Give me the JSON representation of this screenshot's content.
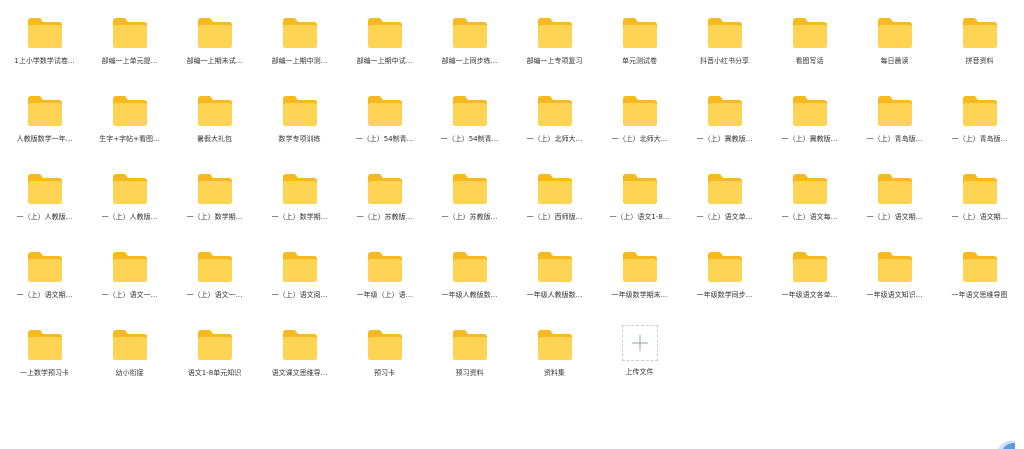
{
  "colors": {
    "folder_back": "#F6B91F",
    "folder_front": "#FFD455",
    "upload_border": "#C9CFDC",
    "upload_plus": "#9AA3B5"
  },
  "folders": [
    {
      "label": "1上小学数学试卷..."
    },
    {
      "label": "部编一上单元提..."
    },
    {
      "label": "部编一上期末试..."
    },
    {
      "label": "部编一上期中测..."
    },
    {
      "label": "部编一上期中试..."
    },
    {
      "label": "部编一上同步练..."
    },
    {
      "label": "部编一上专项复习"
    },
    {
      "label": "单元测试卷"
    },
    {
      "label": "抖音小红书分享"
    },
    {
      "label": "看图写话"
    },
    {
      "label": "每日晨读"
    },
    {
      "label": "拼音资料"
    },
    {
      "label": "人教版数学一年..."
    },
    {
      "label": "生字+字帖+看图..."
    },
    {
      "label": "暑假大礼包"
    },
    {
      "label": "数学专项训练"
    },
    {
      "label": "一（上）54制青..."
    },
    {
      "label": "一（上）54制青..."
    },
    {
      "label": "一（上）北师大..."
    },
    {
      "label": "一（上）北师大..."
    },
    {
      "label": "一（上）冀教版..."
    },
    {
      "label": "一（上）冀教版..."
    },
    {
      "label": "一（上）青岛版..."
    },
    {
      "label": "一（上）青岛版..."
    },
    {
      "label": "一（上）人教版..."
    },
    {
      "label": "一（上）人教版..."
    },
    {
      "label": "一（上）数学期..."
    },
    {
      "label": "一（上）数学期..."
    },
    {
      "label": "一（上）苏教版..."
    },
    {
      "label": "一（上）苏教版..."
    },
    {
      "label": "一（上）西师版..."
    },
    {
      "label": "一（上）语文1-8..."
    },
    {
      "label": "一（上）语文单..."
    },
    {
      "label": "一（上）语文每..."
    },
    {
      "label": "一（上）语文期..."
    },
    {
      "label": "一（上）语文期..."
    },
    {
      "label": "一（上）语文期..."
    },
    {
      "label": "一（上）语文一..."
    },
    {
      "label": "一（上）语文一..."
    },
    {
      "label": "一（上）语文阅..."
    },
    {
      "label": "一年级（上）语..."
    },
    {
      "label": "一年级人教版数..."
    },
    {
      "label": "一年级人教版数..."
    },
    {
      "label": "一年级数学期末..."
    },
    {
      "label": "一年级数学同步..."
    },
    {
      "label": "一年级语文各单..."
    },
    {
      "label": "一年级语文知识..."
    },
    {
      "label": "一年语文思维导图"
    },
    {
      "label": "一上数学预习卡"
    },
    {
      "label": "幼小衔接"
    },
    {
      "label": "语文1-8单元知识"
    },
    {
      "label": "语文课文思维导..."
    },
    {
      "label": "预习卡"
    },
    {
      "label": "预习资料"
    },
    {
      "label": "资料集"
    }
  ],
  "upload": {
    "label": "上传文件",
    "icon": "plus-icon"
  }
}
